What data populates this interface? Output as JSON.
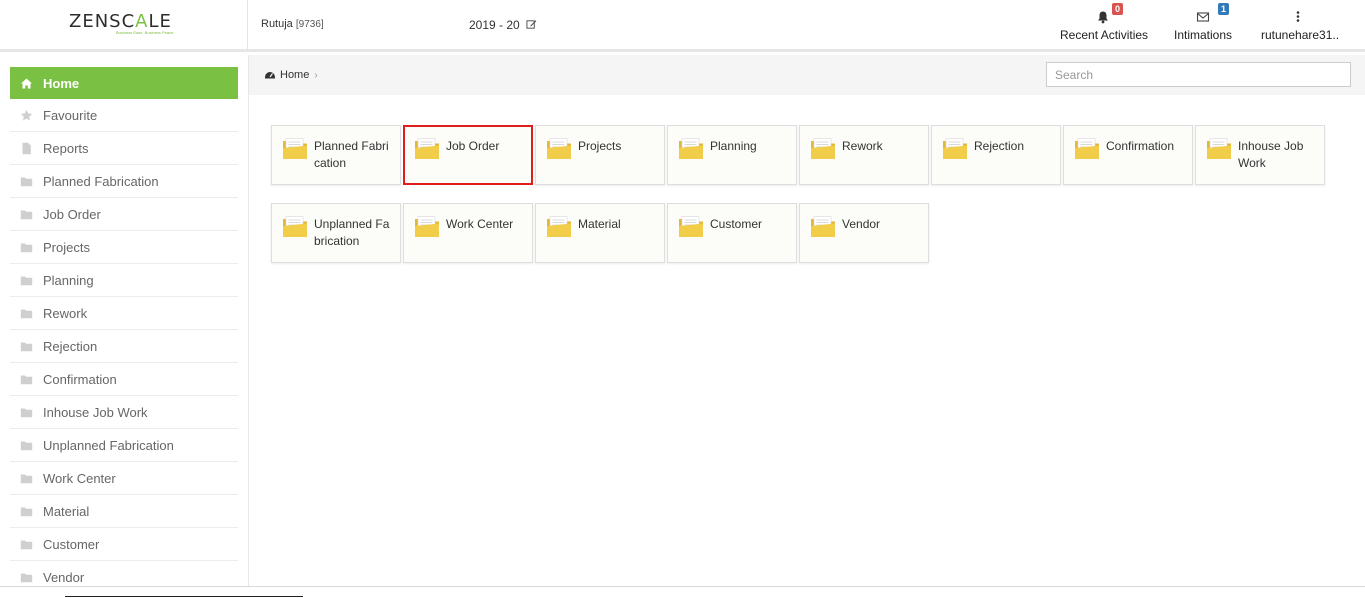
{
  "brand": {
    "name_a": "ZENSC",
    "name_accent": "A",
    "name_b": "LE",
    "tagline": "Business Ease. Business Peace."
  },
  "header": {
    "user": "Rutuja",
    "user_id": "[9736]",
    "fiscal_year": "2019 - 20",
    "recent_activities": {
      "label": "Recent Activities",
      "count": "0",
      "icon": "bell-icon"
    },
    "intimations": {
      "label": "Intimations",
      "count": "1",
      "icon": "envelope-icon"
    },
    "account": {
      "label": "rutunehare31..",
      "icon": "more-vertical-icon"
    }
  },
  "sidebar": {
    "items": [
      {
        "label": "Home",
        "icon": "home-icon",
        "active": true
      },
      {
        "label": "Favourite",
        "icon": "star-icon"
      },
      {
        "label": "Reports",
        "icon": "file-icon"
      },
      {
        "label": "Planned Fabrication",
        "icon": "folder-icon"
      },
      {
        "label": "Job Order",
        "icon": "folder-icon"
      },
      {
        "label": "Projects",
        "icon": "folder-icon"
      },
      {
        "label": "Planning",
        "icon": "folder-icon"
      },
      {
        "label": "Rework",
        "icon": "folder-icon"
      },
      {
        "label": "Rejection",
        "icon": "folder-icon"
      },
      {
        "label": "Confirmation",
        "icon": "folder-icon"
      },
      {
        "label": "Inhouse Job Work",
        "icon": "folder-icon"
      },
      {
        "label": "Unplanned Fabrication",
        "icon": "folder-icon"
      },
      {
        "label": "Work Center",
        "icon": "folder-icon"
      },
      {
        "label": "Material",
        "icon": "folder-icon"
      },
      {
        "label": "Customer",
        "icon": "folder-icon"
      },
      {
        "label": "Vendor",
        "icon": "folder-icon"
      }
    ]
  },
  "breadcrumb": {
    "home": "Home",
    "icon": "dashboard-icon"
  },
  "search": {
    "placeholder": "Search",
    "value": ""
  },
  "tiles": [
    {
      "label": "Planned Fabrication",
      "icon": "folder-icon"
    },
    {
      "label": "Job Order",
      "icon": "folder-icon",
      "selected": true
    },
    {
      "label": "Projects",
      "icon": "folder-icon"
    },
    {
      "label": "Planning",
      "icon": "folder-icon"
    },
    {
      "label": "Rework",
      "icon": "folder-icon"
    },
    {
      "label": "Rejection",
      "icon": "folder-icon"
    },
    {
      "label": "Confirmation",
      "icon": "folder-icon"
    },
    {
      "label": "Inhouse Job Work",
      "icon": "folder-icon"
    },
    {
      "label": "Unplanned Fabrication",
      "icon": "folder-icon"
    },
    {
      "label": "Work Center",
      "icon": "folder-icon"
    },
    {
      "label": "Material",
      "icon": "folder-icon"
    },
    {
      "label": "Customer",
      "icon": "folder-icon"
    },
    {
      "label": "Vendor",
      "icon": "folder-icon"
    }
  ],
  "colors": {
    "accent": "#7ac143",
    "selection": "#e01d1d",
    "badge_red": "#d9534f",
    "badge_blue": "#337ab7",
    "folder": "#f2cd4a"
  }
}
